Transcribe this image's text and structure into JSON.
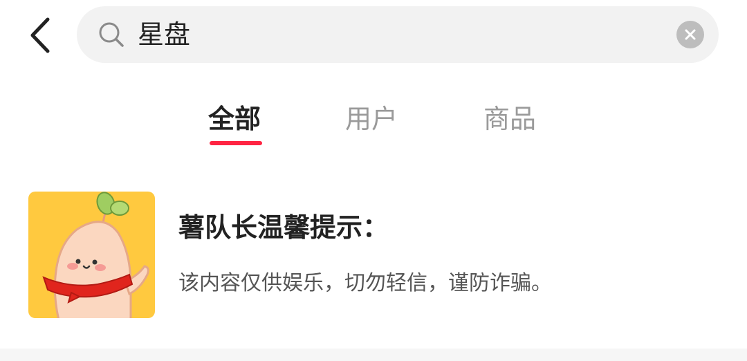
{
  "search": {
    "query": "星盘"
  },
  "tabs": [
    {
      "label": "全部",
      "active": true
    },
    {
      "label": "用户",
      "active": false
    },
    {
      "label": "商品",
      "active": false
    }
  ],
  "notice": {
    "title": "薯队长温馨提示：",
    "body": "该内容仅供娱乐，切勿轻信，谨防诈骗。"
  },
  "icons": {
    "back": "chevron-left-icon",
    "search": "search-icon",
    "clear": "clear-icon",
    "avatar": "potato-mascot-avatar"
  },
  "colors": {
    "accent": "#ff2442",
    "avatar_bg": "#ffc93f",
    "search_bg": "#f2f2f2"
  }
}
